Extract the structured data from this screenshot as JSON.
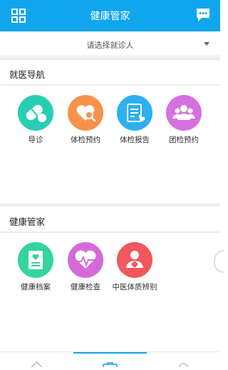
{
  "header": {
    "title": "健康管家",
    "menu_icon": "grid-icon",
    "message_icon": "chat-bubble-icon",
    "bg_color": "#10a6ee"
  },
  "patient_selector": {
    "placeholder": "请选择就诊人",
    "caret_icon": "caret-down-icon"
  },
  "sections": [
    {
      "title": "就医导航",
      "items": [
        {
          "label": "导诊",
          "icon": "pills-icon",
          "color": "#27ceb4"
        },
        {
          "label": "体检预约",
          "icon": "heart-search-icon",
          "color": "#f6924a"
        },
        {
          "label": "体检报告",
          "icon": "report-stethoscope-icon",
          "color": "#2db0ef"
        },
        {
          "label": "团检预约",
          "icon": "group-icon",
          "color": "#d66fe0"
        }
      ]
    },
    {
      "title": "健康管家",
      "items": [
        {
          "label": "健康档案",
          "icon": "health-record-icon",
          "color": "#33d49f"
        },
        {
          "label": "健康检查",
          "icon": "heartbeat-icon",
          "color": "#d46ad9"
        },
        {
          "label": "中医体质辨别",
          "icon": "tcm-person-icon",
          "color": "#f2575e"
        }
      ]
    }
  ],
  "tabbar": {
    "tabs": [
      {
        "icon": "home-icon"
      },
      {
        "icon": "briefcase-icon",
        "active": true
      },
      {
        "icon": "user-icon"
      }
    ],
    "accent": "#10a6ee"
  }
}
